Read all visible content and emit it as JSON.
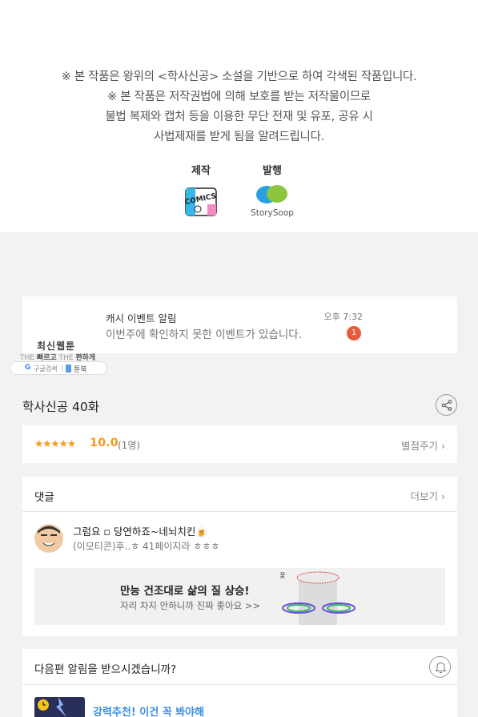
{
  "notice": {
    "lines": [
      "※ 본 작품은 왕위의 <학사신공> 소설을 기반으로 하여 각색된 작품입니다.",
      "※ 본 작품은 저작권법에 의해 보호를 받는 저작물이므로",
      "불법 복제와 캡처 등을 이용한 무단 전재 및 유포, 공유 시",
      "사법제재를 받게 됨을 알려드립니다."
    ],
    "maker_label": "제작",
    "maker_logo_text": "COMICS",
    "publisher_label": "발행",
    "publisher_logo_text": "StorySoop"
  },
  "toast": {
    "title": "캐시 이벤트 알림",
    "message": "이번주에 확인하지 못한 이벤트가 있습니다.",
    "time": "오후 7:32",
    "badge": "1"
  },
  "brand": {
    "title": "최신웹툰",
    "tag_the1": "THE",
    "tag_fast": "빠르고",
    "tag_the2": "THE",
    "tag_easy": "편하게",
    "google_label": "구글검색",
    "bookmark_label": "툰북"
  },
  "episode": {
    "title": "학사신공 40화"
  },
  "rating": {
    "stars": "★★★★★",
    "score": "10.0",
    "raters": "(1명)",
    "rate_link": "별점주기 ›",
    "star_fraction": 1.0
  },
  "comments": {
    "title": "댓글",
    "more": "더보기 ›",
    "items": [
      {
        "author": "그럼요 ▫ 당연하죠~네뇌치킨🍺",
        "text": "(이모티콘)후..ㅎ 41페이지라 ㅎㅎㅎ"
      }
    ]
  },
  "ad": {
    "headline": "만능 건조대로 삶의 질 상승!",
    "subline": "자리 차지 안하니까 진짜 좋아요 >>"
  },
  "next_alert": {
    "title": "다음편 알림을 받으시겠습니까?",
    "recommend": "강력추천! 이건 꼭 봐야해"
  },
  "colors": {
    "accent_orange": "#f29b1e",
    "badge_red": "#e65b3b",
    "link_blue": "#3b8fe0",
    "background": "#f2f2f2"
  },
  "icons": [
    "share-icon",
    "bell-icon",
    "clock-icon",
    "chevron-right-icon",
    "google-icon",
    "bookmark-icon"
  ]
}
